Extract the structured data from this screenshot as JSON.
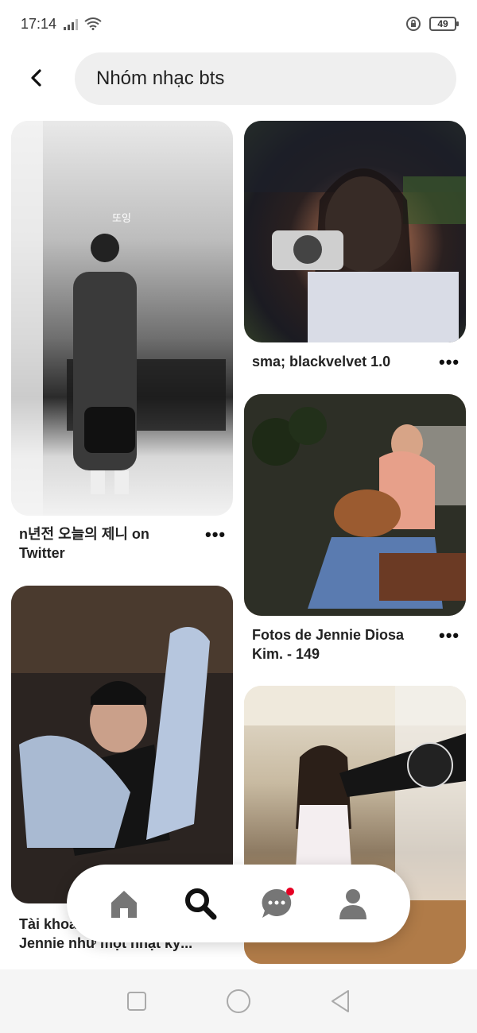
{
  "status_bar": {
    "time": "17:14",
    "battery": "49"
  },
  "search": {
    "query": "Nhóm nhạc bts"
  },
  "pins": [
    {
      "title": "n년전 오늘의 제니 on Twitter",
      "title_line1": "n년전 오늘의 제니 on",
      "title_line2": "Twitter",
      "image_text": "또잉"
    },
    {
      "title": "sma; blackvelvet 1.0"
    },
    {
      "title": "Fotos de Jennie Diosa Kim. - 149",
      "title_line1": "Fotos de Jennie Diosa",
      "title_line2": "Kim. - 149"
    },
    {
      "title_line1": "Tài khoả",
      "title_line2": "Jennie như một nhật ký..."
    },
    {
      "title": ""
    }
  ],
  "more_label": "•••",
  "bottom_nav": {
    "items": [
      "home",
      "search",
      "messages",
      "profile"
    ],
    "active": "search",
    "accent": "#e60023"
  }
}
